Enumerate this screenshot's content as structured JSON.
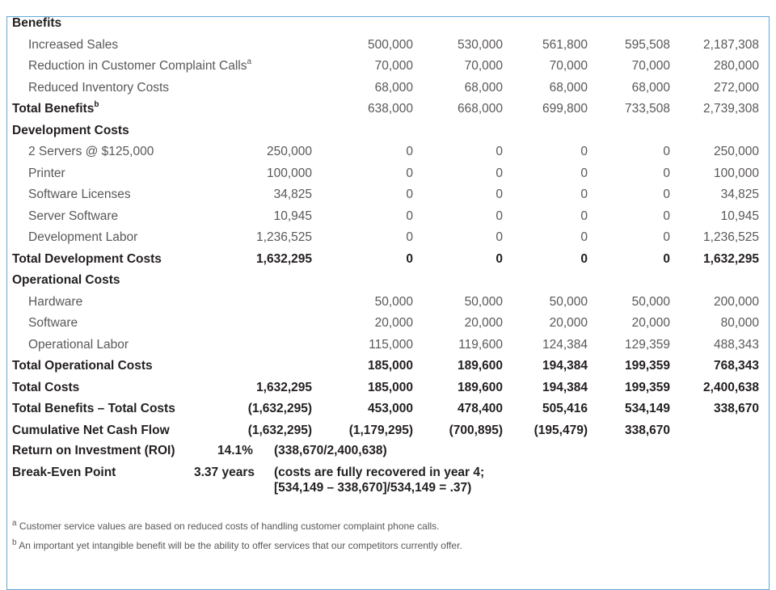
{
  "rows": [
    {
      "label": "Benefits",
      "style": "bold",
      "indent": false,
      "values": [
        "",
        "",
        "",
        "",
        "",
        ""
      ]
    },
    {
      "label": "Increased Sales",
      "style": "light",
      "indent": true,
      "values": [
        "",
        "500,000",
        "530,000",
        "561,800",
        "595,508",
        "2,187,308"
      ]
    },
    {
      "label": "Reduction in Customer Complaint Calls",
      "sup": "a",
      "style": "light",
      "indent": true,
      "values": [
        "",
        "70,000",
        "70,000",
        "70,000",
        "70,000",
        "280,000"
      ]
    },
    {
      "label": "Reduced Inventory Costs",
      "style": "light",
      "indent": true,
      "values": [
        "",
        "68,000",
        "68,000",
        "68,000",
        "68,000",
        "272,000"
      ]
    },
    {
      "label": "Total Benefits",
      "sup": "b",
      "style": "bold",
      "valstyle": "light",
      "indent": false,
      "values": [
        "",
        "638,000",
        "668,000",
        "699,800",
        "733,508",
        "2,739,308"
      ]
    },
    {
      "label": "Development Costs",
      "style": "bold",
      "indent": false,
      "values": [
        "",
        "",
        "",
        "",
        "",
        ""
      ]
    },
    {
      "label": "2 Servers @ $125,000",
      "style": "light",
      "indent": true,
      "values": [
        "250,000",
        "0",
        "0",
        "0",
        "0",
        "250,000"
      ]
    },
    {
      "label": "Printer",
      "style": "light",
      "indent": true,
      "values": [
        "100,000",
        "0",
        "0",
        "0",
        "0",
        "100,000"
      ]
    },
    {
      "label": "Software Licenses",
      "style": "light",
      "indent": true,
      "values": [
        "34,825",
        "0",
        "0",
        "0",
        "0",
        "34,825"
      ]
    },
    {
      "label": "Server Software",
      "style": "light",
      "indent": true,
      "values": [
        "10,945",
        "0",
        "0",
        "0",
        "0",
        "10,945"
      ]
    },
    {
      "label": "Development Labor",
      "style": "light",
      "indent": true,
      "values": [
        "1,236,525",
        "0",
        "0",
        "0",
        "0",
        "1,236,525"
      ]
    },
    {
      "label": "Total Development Costs",
      "style": "bold",
      "indent": false,
      "values": [
        "1,632,295",
        "0",
        "0",
        "0",
        "0",
        "1,632,295"
      ]
    },
    {
      "label": "Operational Costs",
      "style": "bold",
      "indent": false,
      "values": [
        "",
        "",
        "",
        "",
        "",
        ""
      ]
    },
    {
      "label": "Hardware",
      "style": "light",
      "indent": true,
      "values": [
        "",
        "50,000",
        "50,000",
        "50,000",
        "50,000",
        "200,000"
      ]
    },
    {
      "label": "Software",
      "style": "light",
      "indent": true,
      "values": [
        "",
        "20,000",
        "20,000",
        "20,000",
        "20,000",
        "80,000"
      ]
    },
    {
      "label": "Operational Labor",
      "style": "light",
      "indent": true,
      "values": [
        "",
        "115,000",
        "119,600",
        "124,384",
        "129,359",
        "488,343"
      ]
    },
    {
      "label": "Total Operational Costs",
      "style": "bold",
      "indent": false,
      "values": [
        "",
        "185,000",
        "189,600",
        "194,384",
        "199,359",
        "768,343"
      ]
    },
    {
      "label": "Total Costs",
      "style": "bold",
      "indent": false,
      "values": [
        "1,632,295",
        "185,000",
        "189,600",
        "194,384",
        "199,359",
        "2,400,638"
      ]
    },
    {
      "label": "Total Benefits – Total Costs",
      "style": "bold",
      "indent": false,
      "values": [
        "(1,632,295)",
        "453,000",
        "478,400",
        "505,416",
        "534,149",
        "338,670"
      ]
    },
    {
      "label": "Cumulative Net Cash Flow",
      "style": "bold",
      "indent": false,
      "values": [
        "(1,632,295)",
        "(1,179,295)",
        "(700,895)",
        "(195,479)",
        "338,670",
        ""
      ]
    }
  ],
  "roi": {
    "label": "Return on Investment (ROI)",
    "value": "14.1%",
    "formula": "(338,670/2,400,638)"
  },
  "breakeven": {
    "label": "Break-Even Point",
    "value": "3.37 years",
    "note_line1": "(costs are fully recovered in year 4;",
    "note_line2": "[534,149 – 338,670]/534,149 = .37)"
  },
  "footnotes": [
    {
      "mark": "a",
      "text": "Customer service values are based on reduced costs of handling customer complaint phone calls."
    },
    {
      "mark": "b",
      "text": "An important yet intangible benefit will be the ability to offer services that our competitors currently offer."
    }
  ]
}
